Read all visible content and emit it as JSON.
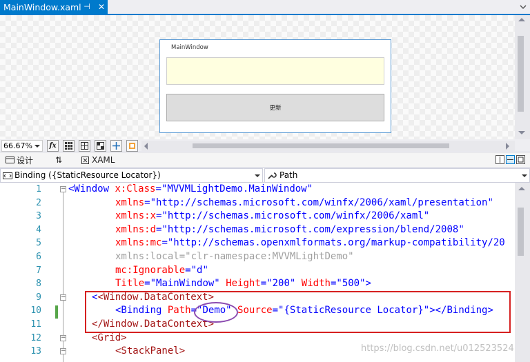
{
  "document_tab": {
    "title": "MainWindow.xaml",
    "pin": "⊣",
    "close": "✕"
  },
  "design": {
    "window_title": "MainWindow",
    "button_label": "更新"
  },
  "toolbar": {
    "zoom": "66.67%",
    "fx_label": "fx"
  },
  "split_tabs": {
    "design_label": "设计",
    "swap_label": "⇅",
    "xaml_label": "XAML"
  },
  "selectors": {
    "left": "Binding ({StaticResource Locator})",
    "right": "Path"
  },
  "code": {
    "line_numbers": [
      "1",
      "2",
      "3",
      "4",
      "5",
      "6",
      "7",
      "8",
      "9",
      "10",
      "11",
      "12",
      "13"
    ],
    "lines": {
      "l1": {
        "p1": "<Window ",
        "a1": "x:Class",
        "e": "=",
        "v1": "\"MVVMLightDemo.MainWindow\""
      },
      "l2": {
        "a": "xmlns",
        "e": "=",
        "v": "\"http://schemas.microsoft.com/winfx/2006/xaml/presentation\""
      },
      "l3": {
        "a": "xmlns:x",
        "e": "=",
        "v": "\"http://schemas.microsoft.com/winfx/2006/xaml\""
      },
      "l4": {
        "a": "xmlns:d",
        "e": "=",
        "v": "\"http://schemas.microsoft.com/expression/blend/2008\""
      },
      "l5": {
        "a": "xmlns:mc",
        "e": "=",
        "v": "\"http://schemas.openxmlformats.org/markup-compatibility/20"
      },
      "l6": {
        "a": "xmlns:local",
        "e": "=",
        "v": "\"clr-namespace:MVVMLightDemo\""
      },
      "l7": {
        "a": "mc:Ignorable",
        "e": "=",
        "v": "\"d\""
      },
      "l8": {
        "a1": "Title",
        "e": "=",
        "v1": "\"MainWindow\"",
        "a2": "Height",
        "v2": "\"200\"",
        "a3": "Width",
        "v3": "\"500\"",
        "end": ">"
      },
      "l9": {
        "text": "<Window.DataContext>"
      },
      "l10": {
        "p1": "<Binding ",
        "a1": "Path",
        "e": "=",
        "v1": "\"Demo\"",
        "a2": "Source",
        "v2": "\"{StaticResource Locator}\"",
        "end": "></Binding>"
      },
      "l11a": {
        "text": "</Window.DataContext>"
      },
      "l11": {
        "text": "<Grid>"
      },
      "l13": {
        "text": "<StackPanel>"
      }
    }
  },
  "watermark": "https://blog.csdn.net/u012523524",
  "colors": {
    "accent": "#007acc",
    "highlight_box": "#d62020",
    "ellipse": "#8b4bb0"
  }
}
